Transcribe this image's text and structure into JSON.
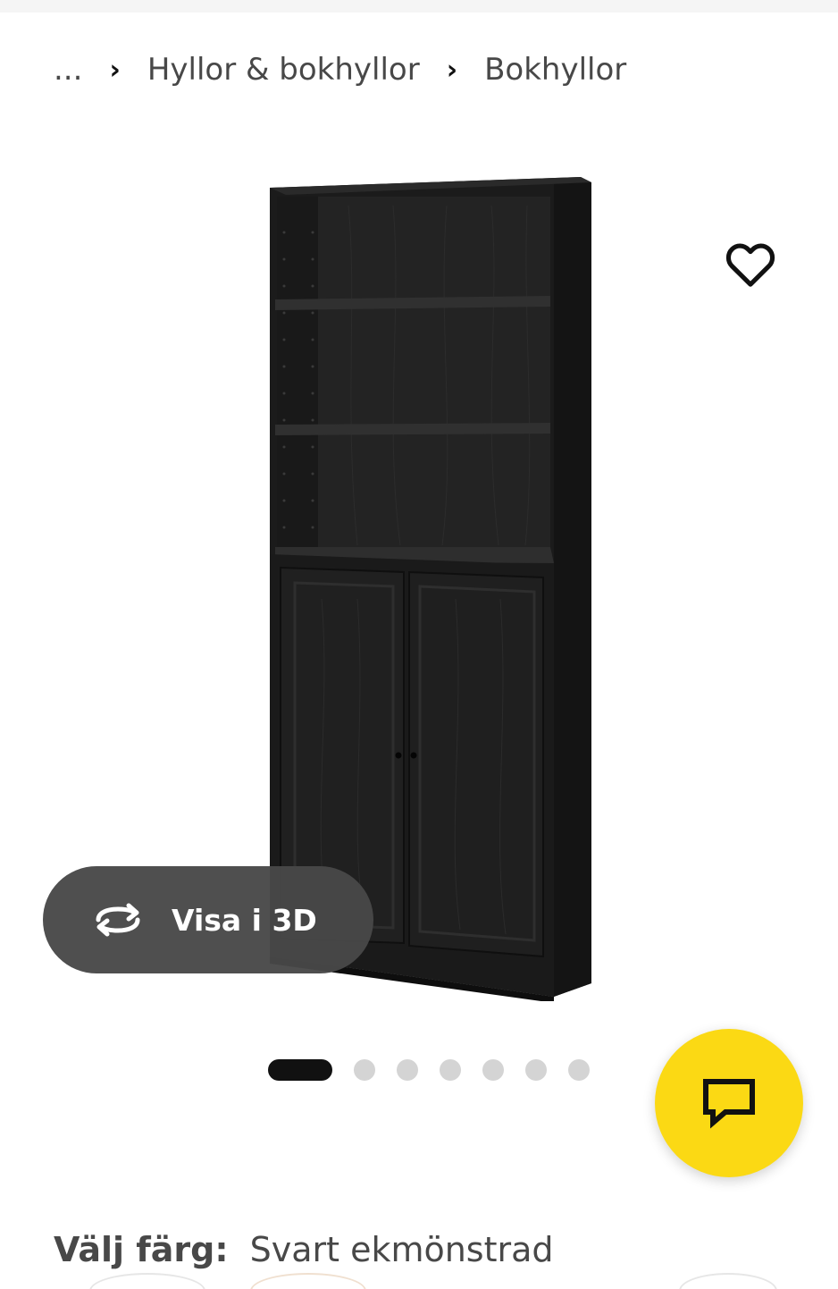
{
  "breadcrumb": {
    "ellipsis": "...",
    "items": [
      "Hyllor & bokhyllor",
      "Bokhyllor"
    ]
  },
  "product": {
    "image_alt_icon": "bookcase-with-doors-image",
    "color": "Svart ekmönstrad"
  },
  "favorite": {
    "icon": "heart-outline-icon"
  },
  "view3d": {
    "label": "Visa i 3D",
    "icon": "rotate-3d-icon"
  },
  "carousel": {
    "total": 7,
    "active_index": 0
  },
  "chat": {
    "icon": "chat-bubble-icon",
    "color": "#fbd914"
  },
  "color_selector": {
    "label": "Välj färg:",
    "value": "Svart ekmönstrad"
  },
  "colors": {
    "accent": "#fbd914",
    "pill_bg": "#484848",
    "dot_active": "#111111",
    "dot_inactive": "#d4d4d4"
  }
}
